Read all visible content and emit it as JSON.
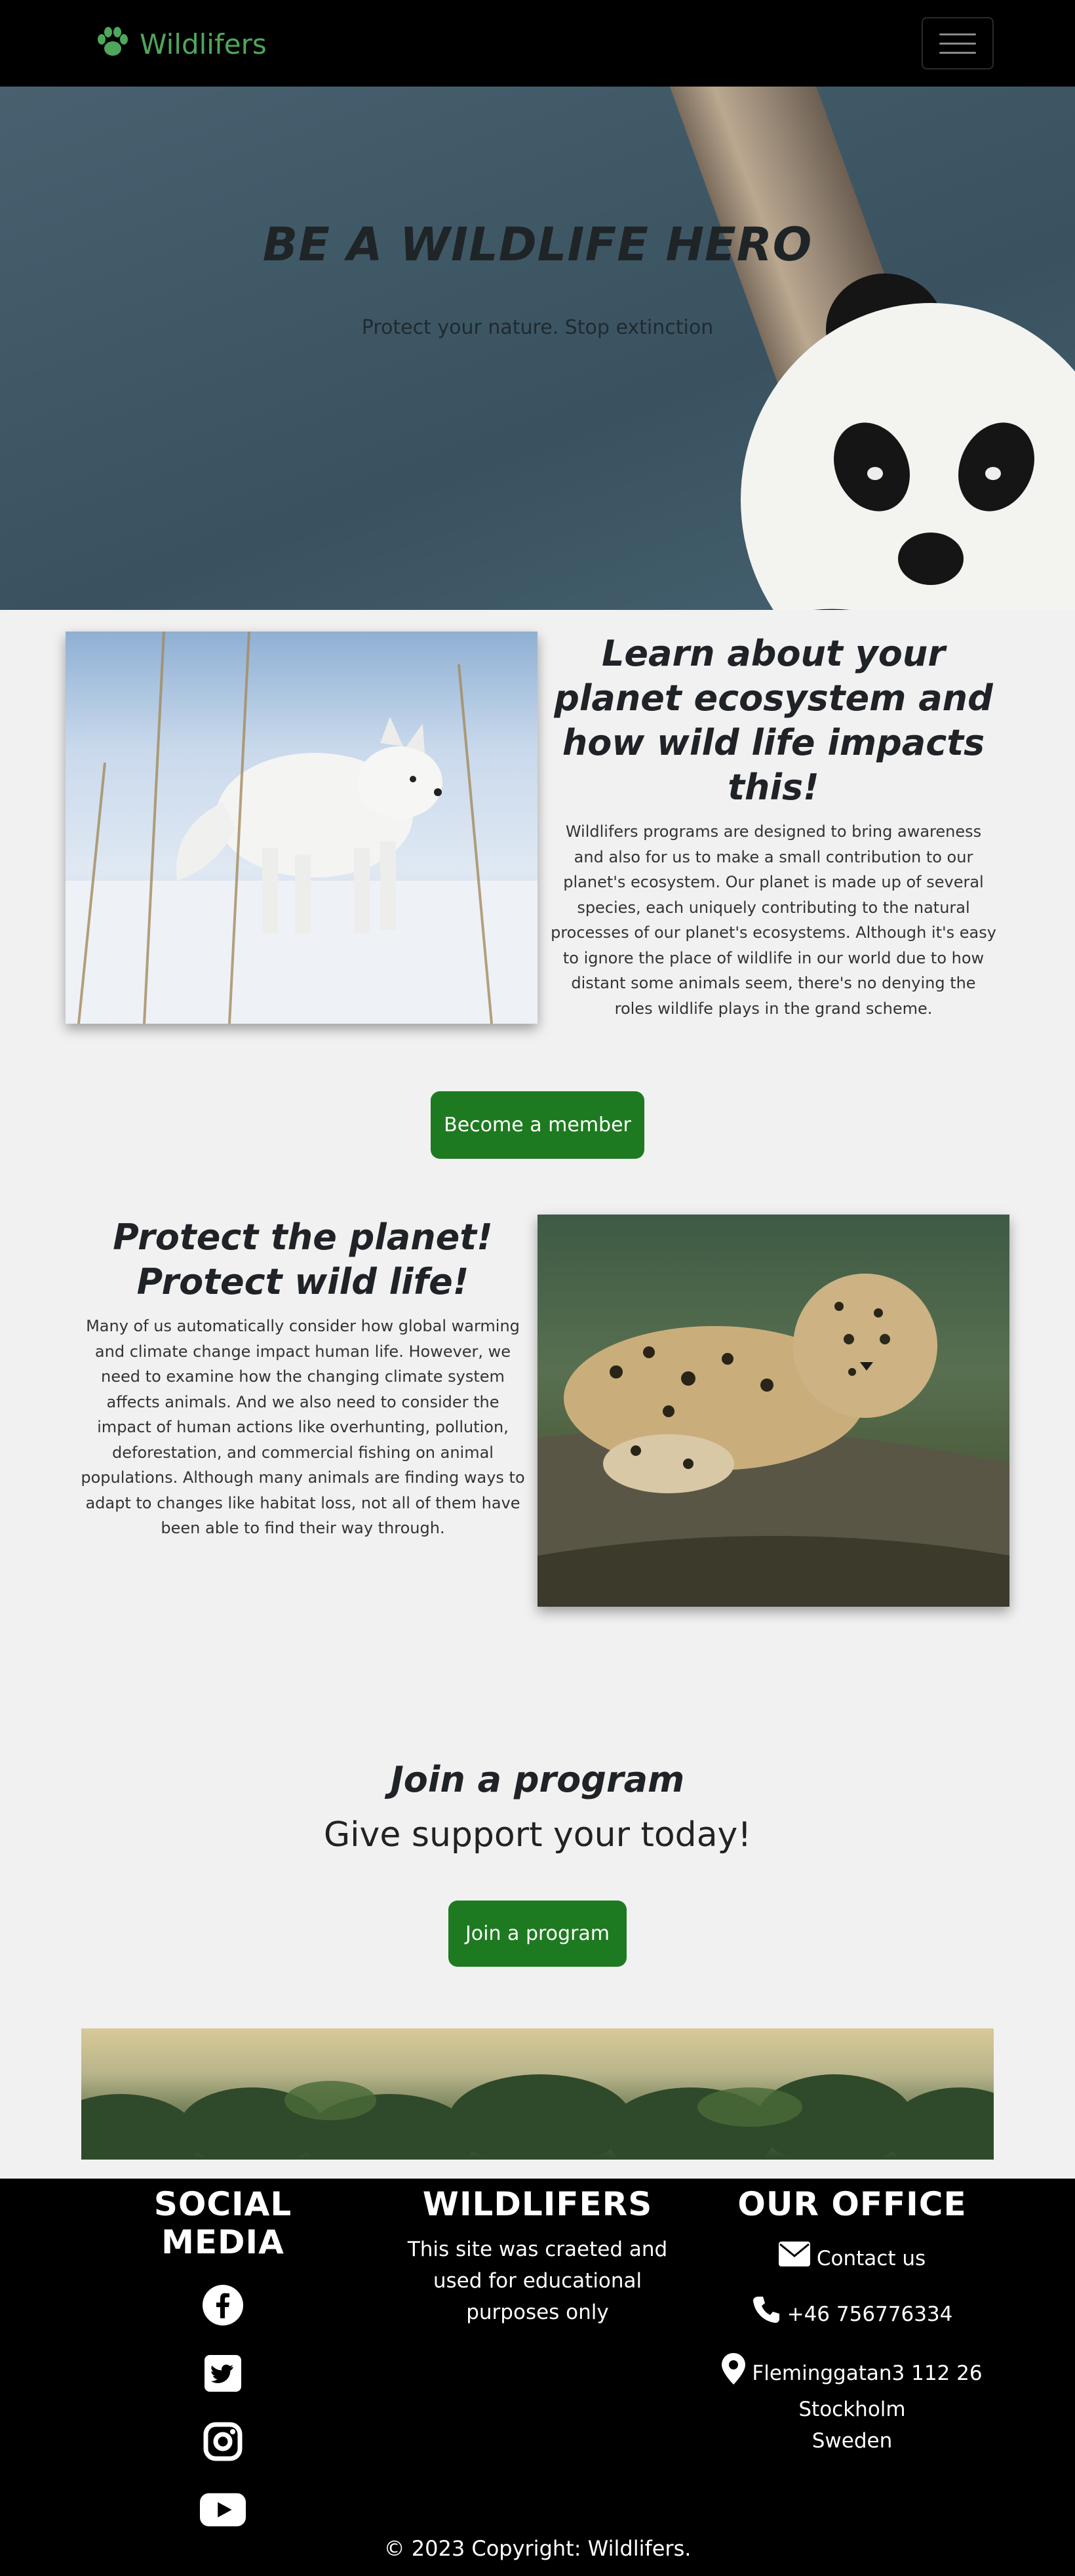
{
  "nav": {
    "brand": "Wildlifers",
    "brand_icon": "paw-icon",
    "menu_icon": "hamburger-icon",
    "brand_color": "#4fa65c"
  },
  "hero": {
    "title": "BE A WILDLIFE HERO",
    "subtitle": "Protect your nature. Stop extinction"
  },
  "learn": {
    "heading": "Learn about your planet ecosystem and how wild life impacts this!",
    "body": "Wildlifers programs are designed to bring awareness and also for us to make a small contribution to our planet's ecosystem. Our planet is made up of several species, each uniquely contributing to the natural processes of our planet's ecosystems. Although it's easy to ignore the place of wildlife in our world due to how distant some animals seem, there's no denying the roles wildlife plays in the grand scheme."
  },
  "member_button": "Become a member",
  "protect": {
    "heading": "Protect the planet! Protect wild life!",
    "body": "Many of us automatically consider how global warming and climate change impact human life. However, we need to examine how the changing climate system affects animals. And we also need to consider the impact of human actions like overhunting, pollution, deforestation, and commercial fishing on animal populations. Although many animals are finding ways to adapt to changes like habitat loss, not all of them have been able to find their way through."
  },
  "join": {
    "title": "Join a program",
    "subtitle": "Give support your today!",
    "button": "Join a program"
  },
  "footer": {
    "social": {
      "heading": "SOCIAL MEDIA",
      "icons": [
        "facebook-icon",
        "twitter-icon",
        "instagram-icon",
        "youtube-icon"
      ]
    },
    "about": {
      "heading": "WILDLIFERS",
      "text": "This site was craeted and used for educational purposes only"
    },
    "office": {
      "heading": "OUR OFFICE",
      "contact": "Contact us",
      "phone": "+46 756776334",
      "address_line1": "Fleminggatan3 112 26",
      "address_line2": "Stockholm",
      "address_line3": "Sweden"
    },
    "copyright": "© 2023 Copyright: Wildlifers."
  },
  "colors": {
    "button_green": "#1e7a20",
    "page_bg": "#f1f1f1",
    "footer_bg": "#000000"
  }
}
